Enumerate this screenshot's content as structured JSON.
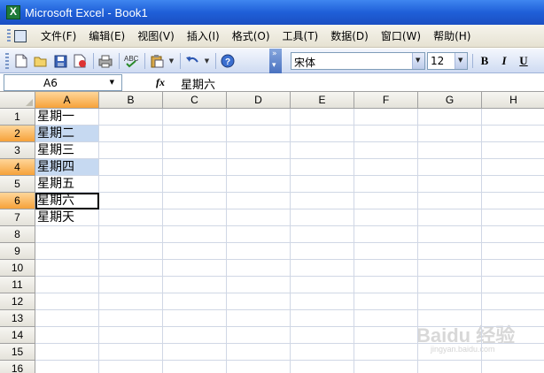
{
  "window": {
    "title": "Microsoft Excel - Book1"
  },
  "menu": [
    "文件(F)",
    "编辑(E)",
    "视图(V)",
    "插入(I)",
    "格式(O)",
    "工具(T)",
    "数据(D)",
    "窗口(W)",
    "帮助(H)"
  ],
  "toolbar": {
    "font_name": "宋体",
    "font_size": "12",
    "bold_label": "B",
    "italic_label": "I",
    "underline_label": "U"
  },
  "formula_bar": {
    "name_box": "A6",
    "fx_label": "fx",
    "value": "星期六"
  },
  "sheet": {
    "columns": [
      "A",
      "B",
      "C",
      "D",
      "E",
      "F",
      "G",
      "H"
    ],
    "rows": [
      "1",
      "2",
      "3",
      "4",
      "5",
      "6",
      "7",
      "8",
      "9",
      "10",
      "11",
      "12",
      "13",
      "14",
      "15",
      "16"
    ],
    "active_column": "A",
    "highlighted_rows": [
      "2",
      "4",
      "6"
    ],
    "active_cell": "A6",
    "cells": {
      "A1": "星期一",
      "A2": "星期二",
      "A3": "星期三",
      "A4": "星期四",
      "A5": "星期五",
      "A6": "星期六",
      "A7": "星期天"
    }
  },
  "watermark": {
    "brand": "Baidu 经验",
    "url": "jingyan.baidu.com"
  },
  "colors": {
    "title_bar": "#2a6ae0",
    "selection": "#c6d9f1",
    "header_active": "#f6a23a"
  }
}
